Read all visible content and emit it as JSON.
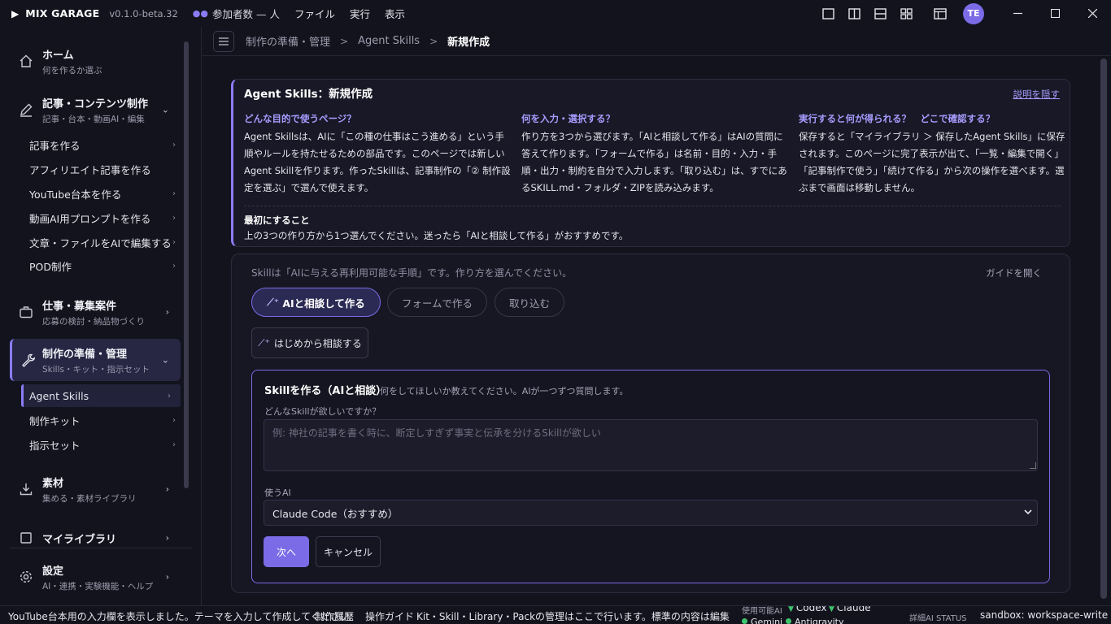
{
  "titlebar": {
    "app_name": "MIX GARAGE",
    "version": "v0.1.0-beta.32",
    "participants": "参加者数 — 人",
    "menus": [
      "ファイル",
      "実行",
      "表示"
    ],
    "avatar_initials": "TE"
  },
  "sidebar": {
    "home": {
      "title": "ホーム",
      "sub": "何を作るか選ぶ"
    },
    "content": {
      "title": "記事・コンテンツ制作",
      "sub": "記事・台本・動画AI・編集"
    },
    "content_items": [
      "記事を作る",
      "アフィリエイト記事を作る",
      "YouTube台本を作る",
      "動画AI用プロンプトを作る",
      "文章・ファイルをAIで編集する",
      "POD制作"
    ],
    "jobs": {
      "title": "仕事・募集案件",
      "sub": "応募の検討・納品物づくり"
    },
    "prep": {
      "title": "制作の準備・管理",
      "sub": "Skills・キット・指示セット"
    },
    "prep_items": [
      "Agent Skills",
      "制作キット",
      "指示セット"
    ],
    "materials": {
      "title": "素材",
      "sub": "集める・素材ライブラリ"
    },
    "library": {
      "title": "マイライブラリ"
    },
    "settings": {
      "title": "設定",
      "sub": "AI・連携・実験機能・ヘルプ"
    }
  },
  "breadcrumb": [
    "制作の準備・管理",
    "Agent Skills",
    "新規作成"
  ],
  "info": {
    "title": "Agent Skills：新規作成",
    "hide_link": "説明を隠す",
    "col1_h": "どんな目的で使うページ？",
    "col1_b": "Agent Skillsは、AIに「この種の仕事はこう進める」という手順やルールを持たせるための部品です。このページでは新しいAgent Skillを作ります。作ったSkillは、記事制作の「② 制作設定を選ぶ」で選んで使えます。",
    "col2_h": "何を入力・選択する？",
    "col2_b": "作り方を3つから選びます。「AIと相談して作る」はAIの質問に答えて作ります。「フォームで作る」は名前・目的・入力・手順・出力・制約を自分で入力します。「取り込む」は、すでにあるSKILL.md・フォルダ・ZIPを読み込みます。",
    "col3_h": "実行すると何が得られる？　どこで確認する？",
    "col3_b": "保存すると「マイライブラリ ＞ 保存したAgent Skills」に保存されます。このページに完了表示が出て、「一覧・編集で開く」「記事制作で使う」「続けて作る」から次の操作を選べます。選ぶまで画面は移動しません。",
    "first_h": "最初にすること",
    "first_b": "上の3つの作り方から1つ選んでください。迷ったら「AIと相談して作る」がおすすめです。"
  },
  "work": {
    "desc": "Skillは「AIに与える再利用可能な手順」です。作り方を選んでください。",
    "guide": "ガイドを開く",
    "tabs": [
      "AIと相談して作る",
      "フォームで作る",
      "取り込む"
    ],
    "consult_btn": "はじめから相談する",
    "form": {
      "title": "Skillを作る（AIと相談）",
      "subtitle": "何をしてほしいか教えてください。AIが一つずつ質問します。",
      "question": "どんなSkillが欲しいですか？",
      "placeholder": "例: 神社の記事を書く時に、断定しすぎず事実と伝承を分けるSkillが欲しい",
      "ai_label": "使うAI",
      "ai_selected": "Claude Code（おすすめ）",
      "next": "次へ",
      "cancel": "キャンセル"
    }
  },
  "statusbar": {
    "message": "YouTube台本用の入力欄を表示しました。テーマを入力して作成してください。",
    "history": "制作履歴",
    "guide": "操作ガイド",
    "notice": "Kit・Skill・Library・Packの管理はここで行います。標準の内容は編集できません（複製して編集）",
    "ai_label": "使用可能AI",
    "ai1": "Codex",
    "ai2": "Claude",
    "ai3": "Gemini",
    "ai4": "Antigravity",
    "status_label": "詳細AI STATUS",
    "sandbox": "sandbox: workspace-write"
  },
  "colors": {
    "accent": "#8b7cf6",
    "background": "#13131d",
    "ok": "#3ec46d"
  }
}
